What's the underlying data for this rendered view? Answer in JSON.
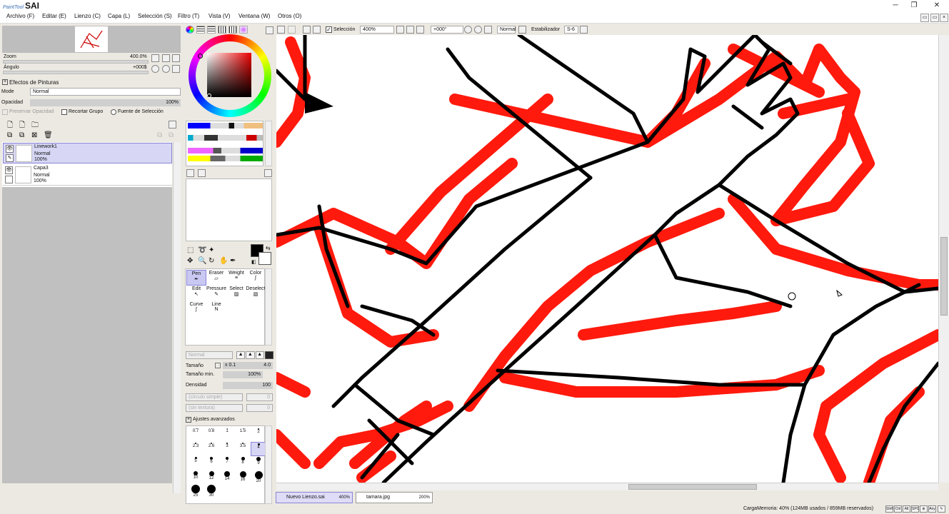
{
  "app": {
    "logo_small": "PaintTool",
    "logo_big": "SAI"
  },
  "window_controls": {
    "minimize": "─",
    "restore": "❐",
    "close": "✕"
  },
  "menu": [
    "Archivo (F)",
    "Editar (E)",
    "Lienzo (C)",
    "Capa (L)",
    "Selección (S)",
    "Filtro (T)",
    "Vista (V)",
    "Ventana (W)",
    "Otros (O)"
  ],
  "navigator": {
    "zoom_label": "Zoom",
    "zoom_value": "400.0%",
    "angle_label": "Ángulo",
    "angle_value": "+000$"
  },
  "paint_effects": {
    "header": "Efectos de Pinturas",
    "mode_label": "Mode",
    "mode_value": "Normal",
    "opacity_label": "Opacidad",
    "opacity_value": "100%",
    "preserve_opacity": "Preservar Opacidad",
    "clip_group": "Recortar Grupo",
    "selection_source": "Fuente de Selección"
  },
  "layers": [
    {
      "name": "Linework1",
      "mode": "Normal",
      "opacity": "100%",
      "selected": true
    },
    {
      "name": "Capa3",
      "mode": "Normal",
      "opacity": "100%",
      "selected": false
    }
  ],
  "tools": [
    {
      "label": "Pen",
      "selected": true
    },
    {
      "label": "Eraser",
      "selected": false
    },
    {
      "label": "Weight",
      "selected": false
    },
    {
      "label": "Color",
      "selected": false
    },
    {
      "label": "Edit",
      "selected": false
    },
    {
      "label": "Pressure",
      "selected": false
    },
    {
      "label": "Select",
      "selected": false
    },
    {
      "label": "Deselect",
      "selected": false
    },
    {
      "label": "Curve",
      "selected": false
    },
    {
      "label": "Line",
      "selected": false
    }
  ],
  "brush_settings": {
    "blend_mode": "Normal",
    "size_label": "Tamaño",
    "size_mult": "x 0.1",
    "size_value": "4.0",
    "min_size_label": "Tamaño min.",
    "min_size_value": "100%",
    "density_label": "Densidad",
    "density_value": "100",
    "shape": "(círculo simple)",
    "shape_value": "0",
    "texture": "(sin textura)",
    "texture_value": "0",
    "advanced": "Ajustes avanzados"
  },
  "brush_sizes": [
    "0.7",
    "0.8",
    "1",
    "1.5",
    "2",
    "2.3",
    "2.6",
    "3",
    "3.5",
    "4",
    "5",
    "6",
    "7",
    "8",
    "9",
    "10",
    "12",
    "14",
    "16",
    "20",
    "25",
    "30"
  ],
  "canvas_toolbar": {
    "selection_label": "Selección",
    "zoom": "400%",
    "angle": "+000°",
    "blend": "Normal",
    "stabilizer_label": "Estabilizador",
    "stabilizer_value": "S-6"
  },
  "tabs": [
    {
      "name": "Nuevo Lienzo.sai",
      "zoom": "400%",
      "active": true
    },
    {
      "name": "tamara.jpg",
      "zoom": "200%",
      "active": false
    }
  ],
  "status": {
    "memory": "CargaMemoria: 40% (124MB usados / 859MB reservados)",
    "keys": [
      "Shift",
      "Ctrl",
      "Alt",
      "SPC",
      "⊕",
      "Any",
      "✎"
    ]
  },
  "colors": {
    "accent": "#8a86d6",
    "canvas_red": "#ff1a0d",
    "fg": "#000000",
    "bg": "#ffffff"
  }
}
